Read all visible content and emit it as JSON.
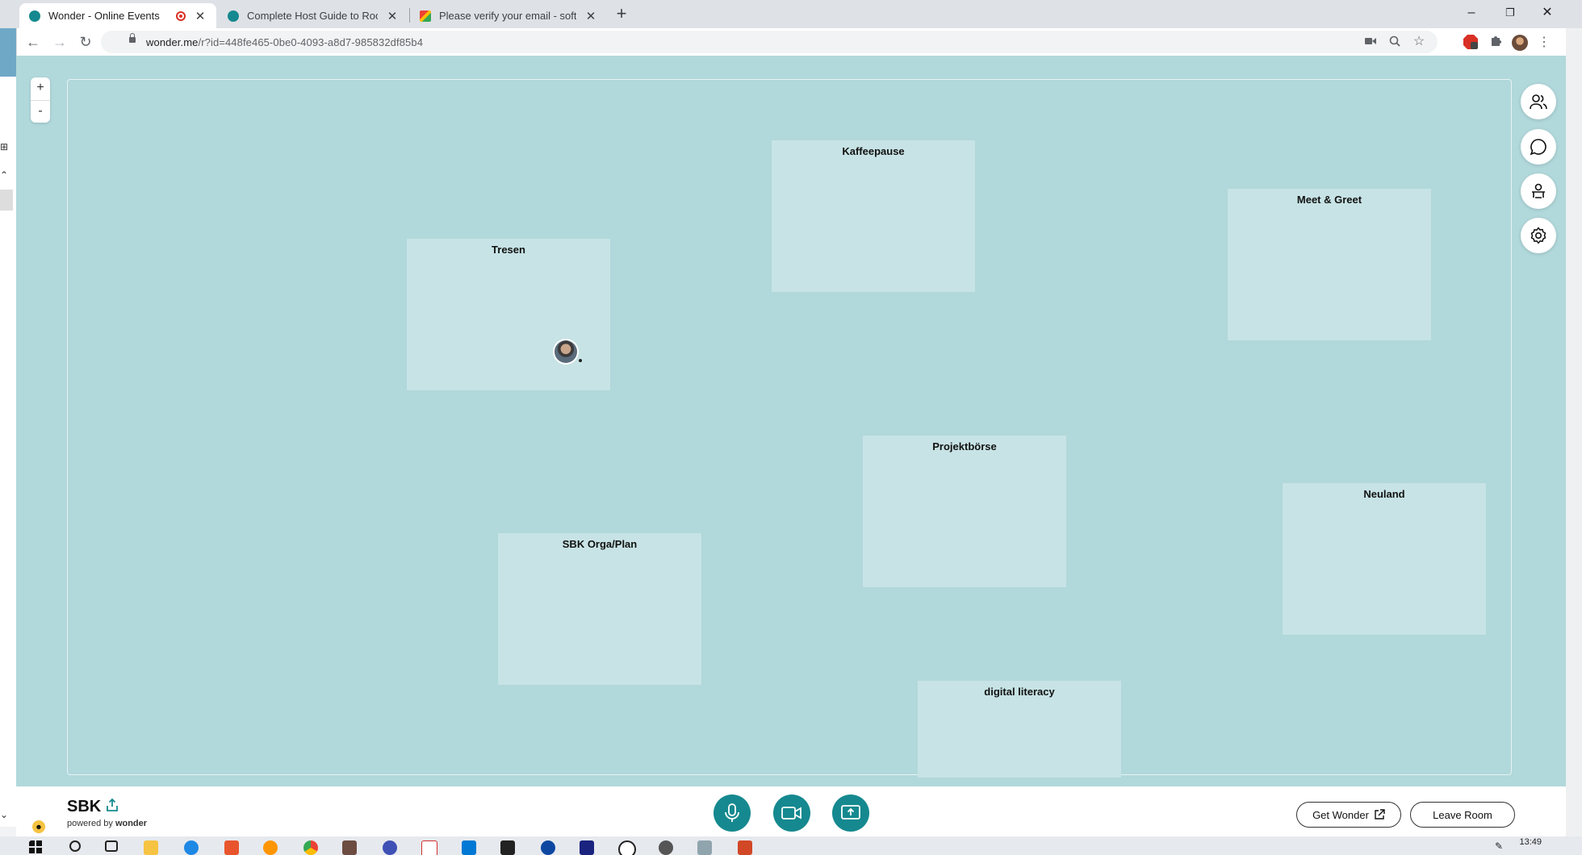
{
  "browser": {
    "tabs": [
      {
        "title": "Wonder - Online Events",
        "active": true,
        "recording": true
      },
      {
        "title": "Complete Host Guide to Room C",
        "active": false
      },
      {
        "title": "Please verify your email - softwa",
        "active": false
      }
    ],
    "new_tab": "+",
    "url_host": "wonder.me",
    "url_path": "/r?id=448fe465-0be0-4093-a8d7-985832df85b4",
    "window_controls": [
      "–",
      "❐",
      "✕"
    ]
  },
  "map": {
    "zoom_in": "+",
    "zoom_out": "-",
    "areas": [
      {
        "name": "Kaffeepause"
      },
      {
        "name": "Meet & Greet"
      },
      {
        "name": "Tresen"
      },
      {
        "name": "Projektbörse"
      },
      {
        "name": "Neuland"
      },
      {
        "name": "SBK Orga/Plan"
      },
      {
        "name": "digital literacy"
      }
    ],
    "side_tools": [
      "people-icon",
      "chat-icon",
      "host-icon",
      "settings-icon"
    ]
  },
  "bottom": {
    "room_name": "SBK",
    "powered_by": "powered by",
    "brand": "wonder",
    "controls": [
      "microphone-icon",
      "camera-icon",
      "screenshare-icon"
    ],
    "get_wonder": "Get Wonder",
    "leave_room": "Leave Room"
  },
  "taskbar": {
    "clock": "13:49"
  },
  "colors": {
    "map_bg": "#b1d8db",
    "area_bg": "#c7e3e5",
    "accent": "#15898f"
  }
}
